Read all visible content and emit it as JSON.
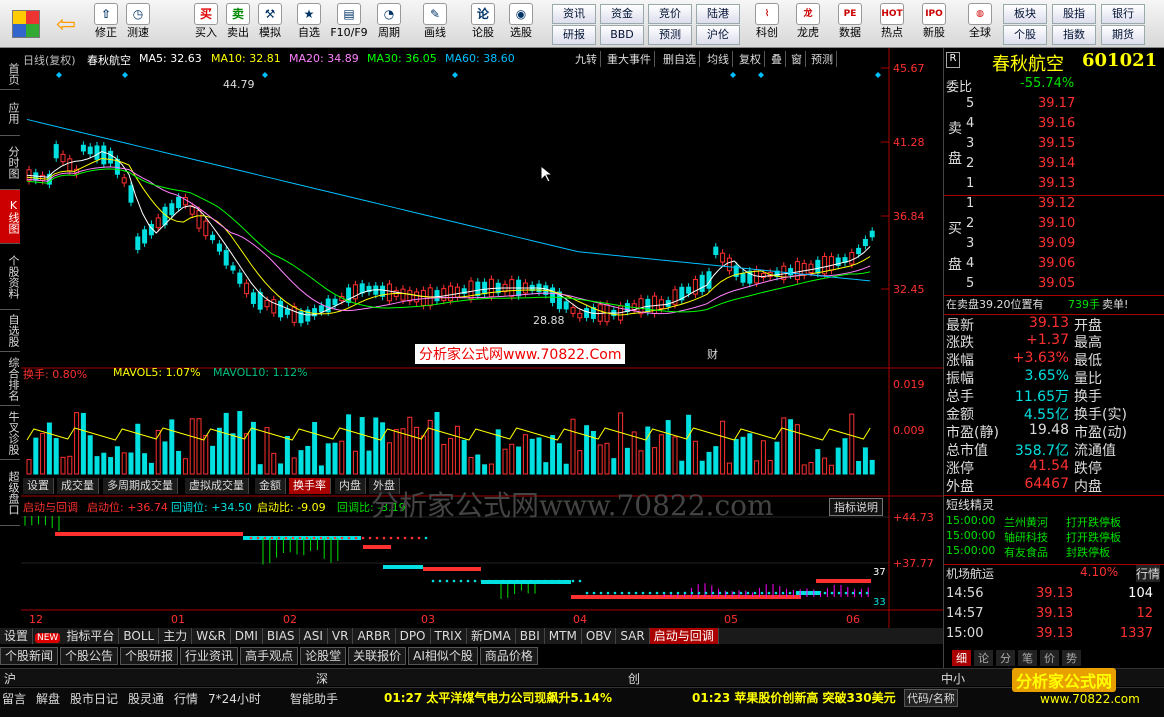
{
  "toolbar": {
    "buttons": [
      {
        "label": "修正",
        "icon": "up-arrow-icon",
        "glyph": "⇧"
      },
      {
        "label": "测速",
        "icon": "clock-icon",
        "glyph": "◷"
      },
      {
        "label": "买入",
        "icon": "buy-icon",
        "glyph": "买"
      },
      {
        "label": "卖出",
        "icon": "sell-icon",
        "glyph": "卖"
      },
      {
        "label": "模拟",
        "icon": "hammer-icon",
        "glyph": "⚒"
      },
      {
        "label": "自选",
        "icon": "star-icon",
        "glyph": "★"
      },
      {
        "label": "F10/F9",
        "icon": "f10-icon",
        "glyph": "▤"
      },
      {
        "label": "周期",
        "icon": "period-icon",
        "glyph": "◔"
      },
      {
        "label": "画线",
        "icon": "pencil-icon",
        "glyph": "✎"
      },
      {
        "label": "论股",
        "icon": "chat-icon",
        "glyph": "论"
      },
      {
        "label": "选股",
        "icon": "filter-icon",
        "glyph": "◉"
      }
    ],
    "grid": [
      [
        "资讯",
        "资金",
        "竞价",
        "陆港"
      ],
      [
        "研报",
        "BBD",
        "预测",
        "沪伦"
      ]
    ],
    "buttons2": [
      {
        "label": "科创",
        "icon": "chart-icon",
        "glyph": "⌇"
      },
      {
        "label": "龙虎",
        "icon": "dragon-icon",
        "glyph": "龙"
      },
      {
        "label": "数据",
        "icon": "pe-icon",
        "glyph": "PE"
      },
      {
        "label": "热点",
        "icon": "hot-icon",
        "glyph": "HOT"
      },
      {
        "label": "新股",
        "icon": "ipo-icon",
        "glyph": "IPO"
      },
      {
        "label": "全球",
        "icon": "globe-icon",
        "glyph": "◍"
      }
    ],
    "grid2": [
      [
        "板块",
        "股指",
        "银行"
      ],
      [
        "个股",
        "指数",
        "期货"
      ]
    ]
  },
  "left_tabs": [
    "首页",
    "应用",
    "分时图",
    "K线图",
    "个股资料",
    "自选股",
    "综合排名",
    "牛叉诊股",
    "超级盘口"
  ],
  "chart": {
    "header": "日线(复权)",
    "name": "春秋航空",
    "ma": [
      {
        "label": "MA5: 32.63",
        "color": "#ffffff"
      },
      {
        "label": "MA10: 32.81",
        "color": "#ffff00"
      },
      {
        "label": "MA20: 34.89",
        "color": "#ff80ff"
      },
      {
        "label": "MA30: 36.05",
        "color": "#00ff00"
      },
      {
        "label": "MA60: 38.60",
        "color": "#00c0ff"
      }
    ],
    "menu": [
      "九转",
      "重大事件",
      "删自选",
      "均线",
      "复权",
      "叠",
      "窗",
      "预测"
    ],
    "price_ticks": [
      "45.67",
      "41.28",
      "36.84",
      "32.45"
    ],
    "high_label": "44.79",
    "low_label": "28.88",
    "watermark": "分析家公式网www.70822.Com",
    "cai": "财",
    "vol_header": [
      {
        "label": "换手: 0.80%",
        "color": "#ff3030"
      },
      {
        "label": "MAVOL5: 1.07%",
        "color": "#ffff00"
      },
      {
        "label": "MAVOL10: 1.12%",
        "color": "#00c080"
      }
    ],
    "vol_ticks": [
      "0.019",
      "0.009"
    ],
    "vol_tabs": [
      "设置",
      "成交量",
      "多周期成交量",
      "虚拟成交量",
      "金额",
      "换手率",
      "内盘",
      "外盘"
    ],
    "ind_header": [
      {
        "label": "启动与回调",
        "color": "#ff3030"
      },
      {
        "label": "启动位: +36.74",
        "color": "#ff3030"
      },
      {
        "label": "回调位: +34.50",
        "color": "#00e0e0"
      },
      {
        "label": "启动比: -9.09",
        "color": "#ffff00"
      },
      {
        "label": "回调比: -3.19",
        "color": "#00e000"
      }
    ],
    "ind_btn": "指标说明",
    "ind_ticks": [
      "+44.73",
      "+37.77"
    ],
    "ind_right": [
      "37",
      "33"
    ],
    "months": [
      "12",
      "01",
      "02",
      "03",
      "04",
      "05",
      "06"
    ],
    "ghost_watermark": "分析家公式网www.70822.com"
  },
  "indicator_tabs": [
    "设置",
    "指标平台",
    "BOLL",
    "主力",
    "W&R",
    "DMI",
    "BIAS",
    "ASI",
    "VR",
    "ARBR",
    "DPO",
    "TRIX",
    "新DMA",
    "BBI",
    "MTM",
    "OBV",
    "SAR",
    "启动与回调"
  ],
  "new_badge": "NEW",
  "news_tabs": [
    "个股新闻",
    "个股公告",
    "个股研报",
    "行业资讯",
    "高手观点",
    "论股堂",
    "关联报价",
    "AI相似个股",
    "商品价格"
  ],
  "quote": {
    "name": "春秋航空",
    "code": "601021",
    "badge": "R",
    "weibi_label": "委比",
    "weibi": "-55.74%",
    "sell_label": [
      "卖",
      "盘"
    ],
    "buy_label": [
      "买",
      "盘"
    ],
    "sell": [
      [
        "5",
        "39.17"
      ],
      [
        "4",
        "39.16"
      ],
      [
        "3",
        "39.15"
      ],
      [
        "2",
        "39.14"
      ],
      [
        "1",
        "39.13"
      ]
    ],
    "buy": [
      [
        "1",
        "39.12"
      ],
      [
        "2",
        "39.10"
      ],
      [
        "3",
        "39.09"
      ],
      [
        "4",
        "39.06"
      ],
      [
        "5",
        "39.05"
      ]
    ],
    "zai": "在卖盘39.20位置有",
    "zai_qty": "739手",
    "zai_tail": "卖单!",
    "stats": [
      [
        "最新",
        "39.13",
        "开盘"
      ],
      [
        "涨跌",
        "+1.37",
        "最高"
      ],
      [
        "涨幅",
        "+3.63%",
        "最低"
      ],
      [
        "振幅",
        "3.65%",
        "量比"
      ],
      [
        "总手",
        "11.65万",
        "换手"
      ],
      [
        "金额",
        "4.55亿",
        "换手(实)"
      ],
      [
        "市盈(静)",
        "19.48",
        "市盈(动)"
      ],
      [
        "总市值",
        "358.7亿",
        "流通值"
      ],
      [
        "涨停",
        "41.54",
        "跌停"
      ],
      [
        "外盘",
        "64467",
        "内盘"
      ]
    ],
    "elf_title": "短线精灵",
    "elf": [
      [
        "15:00:00",
        "兰州黄河",
        "打开跌停板"
      ],
      [
        "15:00:00",
        "轴研科技",
        "打开跌停板"
      ],
      [
        "15:00:00",
        "有友食品",
        "封跌停板"
      ]
    ],
    "jc_label": "机场航运",
    "jc_pct": "4.10%",
    "jc_btn": "行情",
    "ticks": [
      [
        "14:56",
        "39.13",
        "104"
      ],
      [
        "14:57",
        "39.13",
        "12"
      ],
      [
        "15:00",
        "39.13",
        "1337"
      ]
    ],
    "bottom_tabs": [
      "细",
      "论",
      "分",
      "笔",
      "价",
      "势"
    ]
  },
  "markets": [
    "沪",
    "深",
    "创",
    "中小"
  ],
  "status": {
    "items": [
      "留言",
      "解盘",
      "股市日记",
      "股灵通",
      "行情",
      "7*24小时",
      "智能助手"
    ],
    "news1": "01:27 太平洋煤气电力公司现飙升5.14%",
    "news2": "01:23 苹果股价创新高 突破330美元",
    "code_btn": "代码/名称",
    "logo": "分析家公式网",
    "logo_url": "www.70822.com"
  }
}
